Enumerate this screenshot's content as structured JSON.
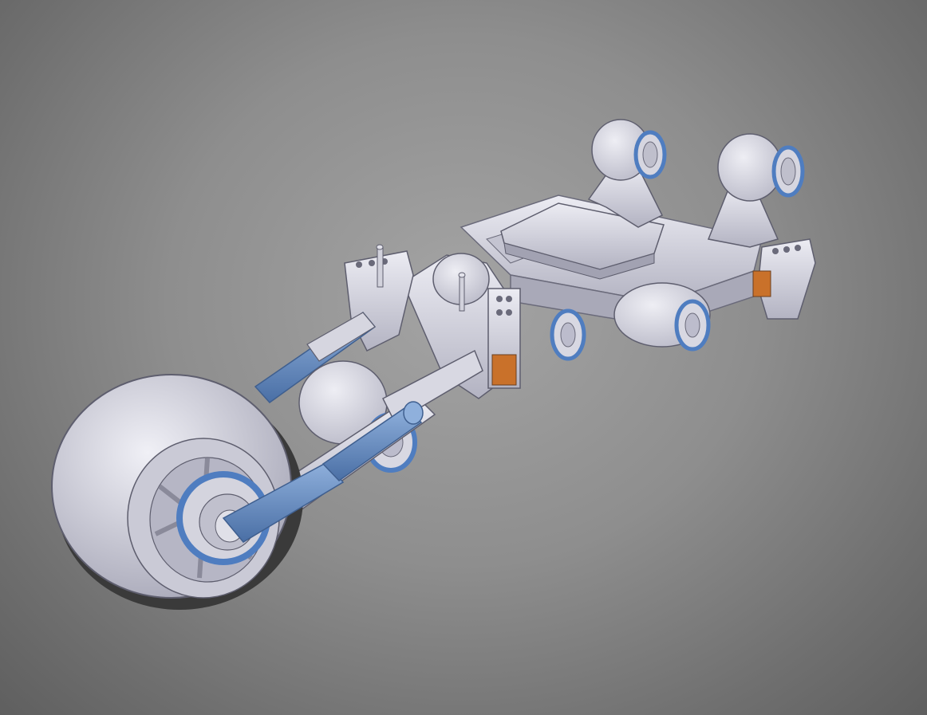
{
  "viewport": {
    "background_top": "#5f5f5f",
    "background_center": "#a4a4a4"
  },
  "model": {
    "body_color": "#d9d9e4",
    "body_shade": "#b7b7c6",
    "accent_blue": "#4f7dc0",
    "accent_orange": "#c9712a",
    "tire_dark": "#2a2a2a"
  }
}
